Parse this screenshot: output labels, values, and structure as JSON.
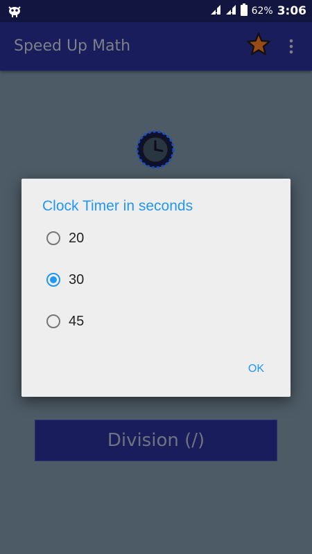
{
  "status_bar": {
    "battery_percent": "62%",
    "time": "3:06"
  },
  "app_bar": {
    "title": "Speed Up Math",
    "icons": [
      "star-icon",
      "overflow-menu-icon"
    ]
  },
  "main": {
    "division_button_label": "Division (/)"
  },
  "dialog": {
    "title": "Clock Timer in seconds",
    "options": [
      {
        "label": "20",
        "checked": false
      },
      {
        "label": "30",
        "checked": true
      },
      {
        "label": "45",
        "checked": false
      }
    ],
    "ok_label": "OK"
  },
  "colors": {
    "accent": "#2196f3",
    "app_bar": "#1a1d5c",
    "background": "#4d5b66",
    "dialog": "#eeeeee"
  }
}
